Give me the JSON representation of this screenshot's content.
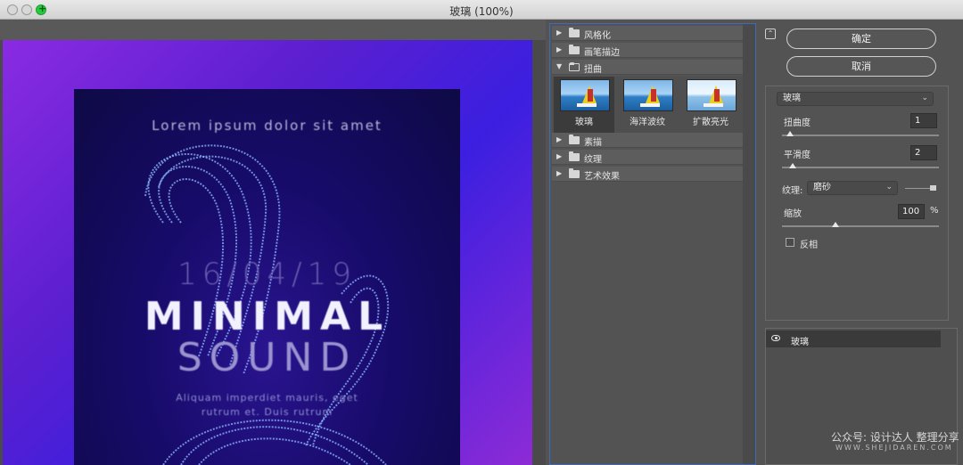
{
  "window": {
    "title": "玻璃 (100%)"
  },
  "poster": {
    "lorem": "Lorem ipsum dolor sit amet",
    "date": "16/04/19",
    "title1": "MINIMAL",
    "title2": "SOUND",
    "line1": "Aliquam imperdiet mauris, eget",
    "line2": "rutrum et. Duis rutrum"
  },
  "gallery": {
    "categories_top": [
      {
        "label": "风格化",
        "open": false
      },
      {
        "label": "画笔描边",
        "open": false
      },
      {
        "label": "扭曲",
        "open": true
      }
    ],
    "distort_filters": [
      {
        "label": "玻璃",
        "selected": true
      },
      {
        "label": "海洋波纹",
        "selected": false
      },
      {
        "label": "扩散亮光",
        "selected": false
      }
    ],
    "categories_bottom": [
      {
        "label": "素描",
        "open": false
      },
      {
        "label": "纹理",
        "open": false
      },
      {
        "label": "艺术效果",
        "open": false
      }
    ]
  },
  "panel": {
    "ok_label": "确定",
    "cancel_label": "取消",
    "filter_select": "玻璃",
    "distortion_label": "扭曲度",
    "distortion_value": "1",
    "smoothness_label": "平滑度",
    "smoothness_value": "2",
    "texture_label": "纹理:",
    "texture_select": "磨砂",
    "scaling_label": "缩放",
    "scaling_value": "100",
    "scaling_unit": "%",
    "invert_label": "反相",
    "invert_checked": false
  },
  "layers": [
    {
      "name": "玻璃",
      "visible": true
    }
  ],
  "watermark": {
    "line1": "公众号: 设计达人 整理分享",
    "line2": "WWW.SHEJIDAREN.COM"
  },
  "colors": {
    "accent_blue": "#3d6bb8",
    "zoom_green": "#28c840"
  }
}
